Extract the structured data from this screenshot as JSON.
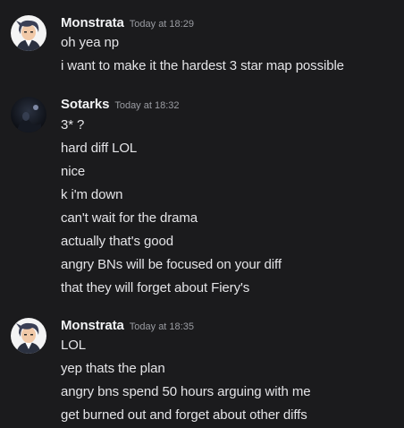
{
  "messages": [
    {
      "username": "Monstrata",
      "timestamp": "Today at 18:29",
      "avatar_icon": "anime-character-avatar-icon",
      "lines": [
        "oh yea np",
        "i want to make it the hardest 3 star map possible"
      ]
    },
    {
      "username": "Sotarks",
      "timestamp": "Today at 18:32",
      "avatar_icon": "dark-night-photo-avatar-icon",
      "lines": [
        "3* ?",
        "hard diff LOL",
        "nice",
        "k i'm down",
        "can't wait for the drama",
        "actually that's good",
        "angry BNs will be focused on your diff",
        "that they will forget about Fiery's"
      ]
    },
    {
      "username": "Monstrata",
      "timestamp": "Today at 18:35",
      "avatar_icon": "anime-character-avatar-icon",
      "lines": [
        "LOL",
        "yep thats the plan",
        "angry bns spend 50 hours arguing with me",
        "get burned out and forget about other diffs"
      ]
    }
  ],
  "colors": {
    "background": "#1b1b1d",
    "username": "#f2f3f5",
    "timestamp": "#9a9ca2",
    "text": "#e4e4e7"
  }
}
